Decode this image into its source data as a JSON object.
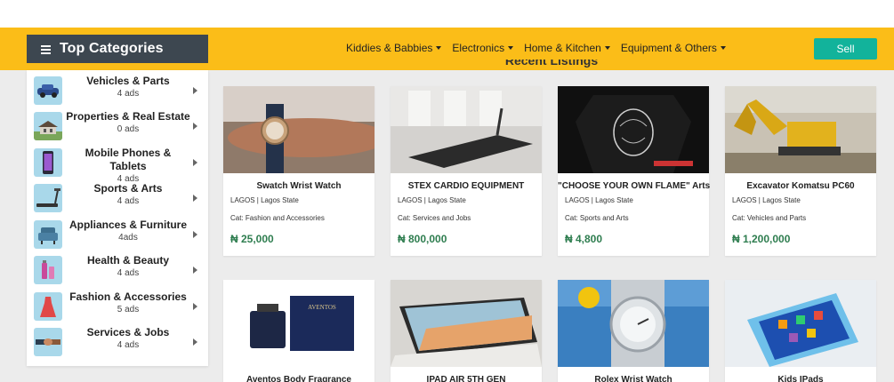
{
  "header": {
    "categories_title": "Top Categories",
    "nav": [
      {
        "label": "Kiddies & Babbies"
      },
      {
        "label": "Electronics"
      },
      {
        "label": "Home & Kitchen"
      },
      {
        "label": "Equipment & Others"
      }
    ],
    "sell_label": "Sell"
  },
  "section_title": "Recent Listings",
  "sidebar": {
    "items": [
      {
        "name": "Vehicles & Parts",
        "count": "4 ads",
        "icon": "car-icon"
      },
      {
        "name": "Properties & Real Estate",
        "count": "0 ads",
        "icon": "house-icon"
      },
      {
        "name": "Mobile Phones & Tablets",
        "count": "4 ads",
        "icon": "phone-icon"
      },
      {
        "name": "Sports & Arts",
        "count": "4 ads",
        "icon": "treadmill-icon"
      },
      {
        "name": "Appliances & Furniture",
        "count": "4ads",
        "icon": "armchair-icon"
      },
      {
        "name": "Health & Beauty",
        "count": "4 ads",
        "icon": "cosmetics-icon"
      },
      {
        "name": "Fashion & Accessories",
        "count": "5 ads",
        "icon": "dress-icon"
      },
      {
        "name": "Services & Jobs",
        "count": "4 ads",
        "icon": "handshake-icon"
      }
    ]
  },
  "listings": [
    {
      "title": "Swatch Wrist Watch",
      "location": "LAGOS | Lagos State",
      "category": "Cat: Fashion and Accessories",
      "price": "₦ 25,000"
    },
    {
      "title": "STEX CARDIO EQUIPMENT",
      "location": "LAGOS | Lagos State",
      "category": "Cat: Services and Jobs",
      "price": "₦ 800,000"
    },
    {
      "title": "\"CHOOSE YOUR OWN FLAME\" Arts",
      "location": "LAGOS | Lagos State",
      "category": "Cat: Sports and Arts",
      "price": "₦ 4,800"
    },
    {
      "title": "Excavator Komatsu PC60",
      "location": "LAGOS | Lagos State",
      "category": "Cat: Vehicles and Parts",
      "price": "₦ 1,200,000"
    },
    {
      "title": "Aventos Body Fragrance",
      "brand_text": "AVENTOS"
    },
    {
      "title": "IPAD AIR 5TH GEN"
    },
    {
      "title": "Rolex Wrist Watch"
    },
    {
      "title": "Kids IPads"
    }
  ],
  "colors": {
    "navbar": "#fbbd18",
    "category_header": "#3d4750",
    "sell_button": "#12b39b",
    "price": "#2e7d4f"
  }
}
